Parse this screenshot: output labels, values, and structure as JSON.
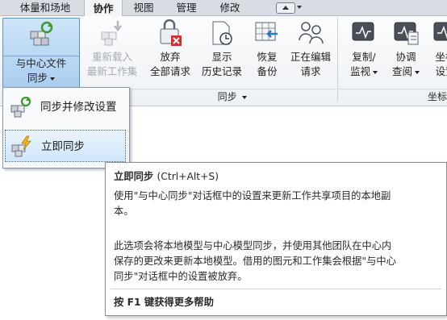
{
  "tabs": [
    {
      "label": "体量和场地"
    },
    {
      "label": "协作"
    },
    {
      "label": "视图"
    },
    {
      "label": "管理"
    },
    {
      "label": "修改"
    }
  ],
  "ribbon": {
    "buttons": [
      {
        "line1": "与中心文件",
        "line2": "同步",
        "icon": "sync-central-icon",
        "state": "pressed"
      },
      {
        "line1": "重新载入",
        "line2": "最新工作集",
        "icon": "reload-latest-icon",
        "state": "disabled"
      },
      {
        "line1": "放弃",
        "line2": "全部请求",
        "icon": "relinquish-all-icon"
      },
      {
        "line1": "显示",
        "line2": "历史记录",
        "icon": "show-history-icon"
      },
      {
        "line1": "恢复",
        "line2": "备份",
        "icon": "restore-backup-icon"
      },
      {
        "line1": "正在编辑",
        "line2": "请求",
        "icon": "editing-requests-icon"
      },
      {
        "line1": "复制/",
        "line2": "监视",
        "icon": "copy-monitor-icon"
      },
      {
        "line1": "协调",
        "line2": "查阅",
        "icon": "coordination-review-icon"
      },
      {
        "line1": "坐标",
        "line2": "设置",
        "icon": "coordinates-icon"
      }
    ],
    "panels": [
      {
        "label": "同步"
      },
      {
        "label": "坐标"
      }
    ]
  },
  "menu": {
    "items": [
      {
        "label": "同步并修改设置",
        "icon": "sync-modify-settings-icon"
      },
      {
        "label": "立即同步",
        "icon": "sync-now-icon",
        "state": "hover"
      }
    ]
  },
  "tooltip": {
    "title": "立即同步",
    "shortcut": "(Ctrl+Alt+S)",
    "desc_line1": "使用\"与中心同步\"对话框中的设置来更新工作共享项目的本地副",
    "desc_line2": "本。",
    "detail_line1": "此选项会将本地模型与中心模型同步，并使用其他团队在中心内",
    "detail_line2": "保存的更改来更新本地模型。借用的图元和工作集会根据\"与中心",
    "detail_line3": "同步\"对话框中的设置被放弃。",
    "help": "按 F1 键获得更多帮助"
  },
  "colors": {
    "ribbon_bg": "#eef1f4",
    "pressed_bg": "#a9cdee",
    "pressed_border": "#5b8fc6",
    "hover_border": "#3b6fae",
    "disabled_text": "#a7abb1"
  }
}
